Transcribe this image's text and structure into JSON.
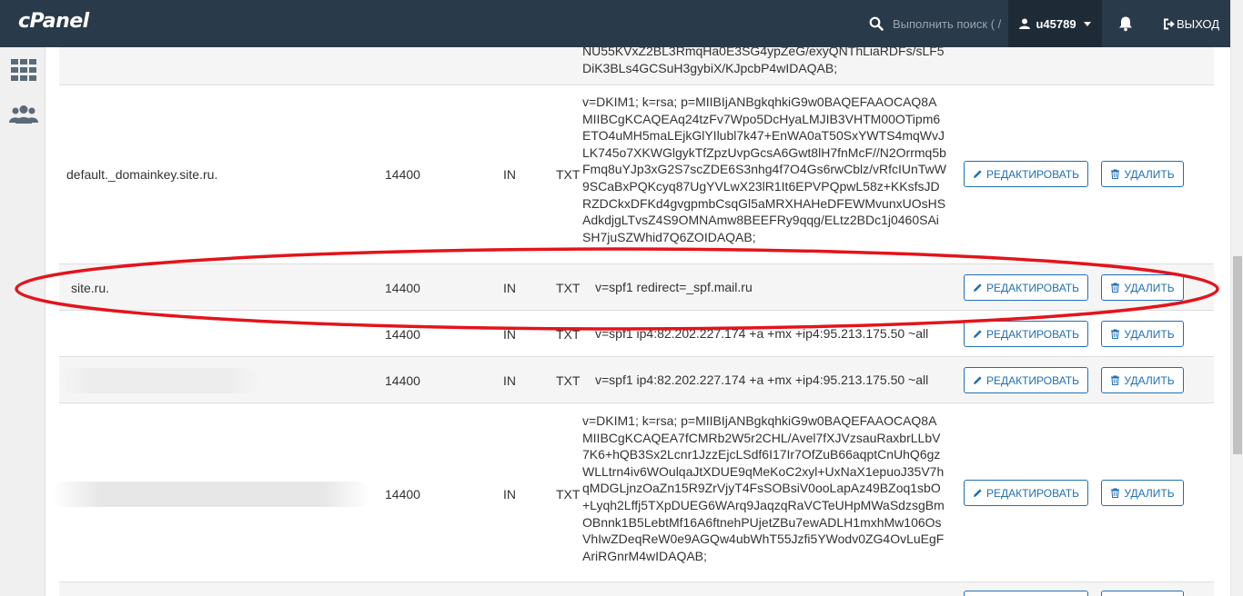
{
  "header": {
    "logo": "cPanel",
    "search_placeholder": "Выполнить поиск ( /",
    "username": "u45789",
    "logout_label": "ВЫХОД"
  },
  "sidebar": {
    "icons": [
      "grid-icon",
      "users-icon"
    ]
  },
  "buttons": {
    "edit_label": "РЕДАКТИРОВАТЬ",
    "delete_label": "УДАЛИТЬ"
  },
  "rows": [
    {
      "name": "",
      "ttl": "",
      "class": "",
      "type": "",
      "record": "NU55KVxZ2BL3RmqHa0E3SG4ypZeG/exyQNThLiaRDFs/sLF5DiK3BLs4GCSuH3gybiX/KJpcbP4wIDAQAB;"
    },
    {
      "name": "default._domainkey.site.ru.",
      "ttl": "14400",
      "class": "IN",
      "type": "TXT",
      "record": "v=DKIM1; k=rsa; p=MIIBIjANBgkqhkiG9w0BAQEFAAOCAQ8AMIIBCgKCAQEAq24tzFv7Wpo5DcHyaLMJIB3VHTM00OTipm6ETO4uMH5maLEjkGlYIlubl7k47+EnWA0aT50SxYWTS4mqWvJLK745o7XKWGlgykTfZpzUvpGcsA6Gwt8lH7fnMcF//N2Orrmq5bFmq8uYJp3xG2S7scZDE6S3nhg4f7O4Gs6rwCblz/vRfcIUnTwW9SCaBxPQKcyq87UgYVLwX23lR1It6EPVPQpwL58z+KKsfsJDRZDCkxDFKd4gvgpmbCsqGl5aMRXHAHeDFEWMvunxUOsHSAdkdjgLTvsZ4S9OMNAmw8BEEFRy9qqg/ELtz2BDc1j0460SAiSH7juSZWhid7Q6ZOIDAQAB;"
    },
    {
      "name": "site.ru.",
      "ttl": "14400",
      "class": "IN",
      "type": "TXT",
      "record": "v=spf1 redirect=_spf.mail.ru"
    },
    {
      "name": "",
      "ttl": "14400",
      "class": "IN",
      "type": "TXT",
      "record": "v=spf1 ip4:82.202.227.174 +a +mx +ip4:95.213.175.50 ~all"
    },
    {
      "name": "",
      "ttl": "14400",
      "class": "IN",
      "type": "TXT",
      "record": "v=spf1 ip4:82.202.227.174 +a +mx +ip4:95.213.175.50 ~all"
    },
    {
      "name": "",
      "ttl": "14400",
      "class": "IN",
      "type": "TXT",
      "record": "v=DKIM1; k=rsa; p=MIIBIjANBgkqhkiG9w0BAQEFAAOCAQ8AMIIBCgKCAQEA7fCMRb2W5r2CHL/Avel7fXJVzsauRaxbrLLbV7K6+hQB3Sx2Lcnr1JzzEjcLSdf6I17Ir7OfZuB66aqptCnUhQ6gzWLLtrn4iv6WOulqaJtXDUE9qMeKoC2xyl+UxNaX1epuoJ35V7hqMDGLjnzOaZn15R9ZrVjyT4FsSOBsiV0ooLapAz49BZoq1sbO+Lyqh2Lffj5TXpDUEG6WArq9JaqzqRaVCTeUHpMWaSdzsgBmOBnnk1B5LebtMf16A6ftnehPUjetZBu7ewADLH1mxhMw106OsVhIwZDeqReW0e9AGQw4ubWhT55Jzfi5YWodv0ZG4OvLuEgFAriRGnrM4wIDAQAB;"
    }
  ]
}
